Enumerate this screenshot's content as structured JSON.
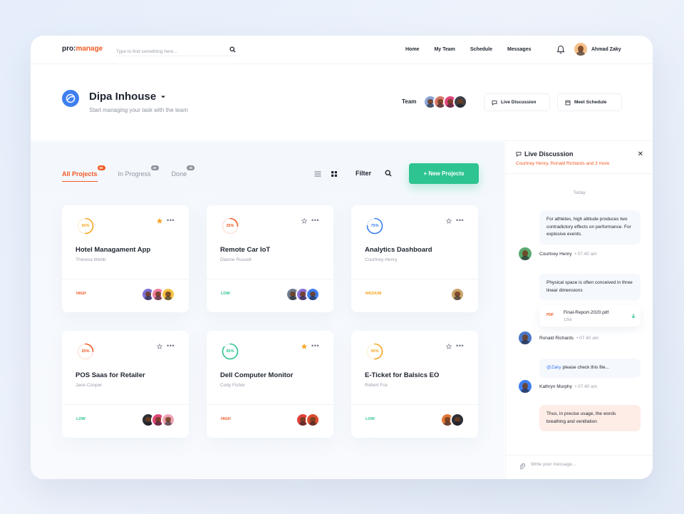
{
  "app": {
    "logo_left": "pro:",
    "logo_right": "manage",
    "search_placeholder": "Type to find something here...",
    "nav": [
      "Home",
      "My Team",
      "Schedule",
      "Messages"
    ],
    "user_name": "Ahmad Zaky"
  },
  "header": {
    "title": "Dipa Inhouse",
    "subtitle": "Start managing your task with the team",
    "team_label": "Team",
    "live_button": "Live Discussion",
    "meet_button": "Meet Schedule",
    "team_avatar_colors": [
      "#8aa4d6",
      "#d9776b",
      "#e0457b",
      "#3b3f47"
    ]
  },
  "toolbar": {
    "tabs": [
      {
        "label": "All Projects",
        "count": "50"
      },
      {
        "label": "In Progress",
        "count": "20"
      },
      {
        "label": "Done",
        "count": "30"
      }
    ],
    "filter_label": "Filter",
    "new_button": "+ New Projects"
  },
  "projects": [
    {
      "title": "Hotel Managament App",
      "owner": "Theresa Webb",
      "progress": "50%",
      "progress_value": 0.5,
      "ring_color": "#f5a623",
      "priority": "HIGH",
      "priority_color": "#f15a24",
      "starred": true,
      "avatars": [
        "#7d6fd6",
        "#f27ea2",
        "#f5c344"
      ]
    },
    {
      "title": "Remote Car IoT",
      "owner": "Dianne Russell",
      "progress": "25%",
      "progress_value": 0.25,
      "ring_color": "#f15a24",
      "priority": "LOW",
      "priority_color": "#2ec491",
      "starred": false,
      "avatars": [
        "#6c7a8c",
        "#8a6fd6",
        "#3f7ff0"
      ]
    },
    {
      "title": "Analytics Dashboard",
      "owner": "Courtney Henry",
      "progress": "75%",
      "progress_value": 0.75,
      "ring_color": "#3f7ff0",
      "priority": "MEDIUM",
      "priority_color": "#f5a623",
      "starred": false,
      "avatars": [
        "#c9a36a"
      ]
    },
    {
      "title": "POS Saas for Retailer",
      "owner": "Jane Cooper",
      "progress": "25%",
      "progress_value": 0.25,
      "ring_color": "#f15a24",
      "priority": "LOW",
      "priority_color": "#2ec491",
      "starred": false,
      "avatars": [
        "#2b2f36",
        "#e0457b",
        "#f0a3b5"
      ]
    },
    {
      "title": "Dell Computer Monitor",
      "owner": "Cody Fisher",
      "progress": "85%",
      "progress_value": 0.85,
      "ring_color": "#2ec491",
      "priority": "HIGH",
      "priority_color": "#f15a24",
      "starred": true,
      "avatars": [
        "#e0413a",
        "#d94c2e"
      ]
    },
    {
      "title": "E-Ticket for Balsics EO",
      "owner": "Robert Fox",
      "progress": "50%",
      "progress_value": 0.5,
      "ring_color": "#f5a623",
      "priority": "LOW",
      "priority_color": "#2ec491",
      "starred": false,
      "avatars": [
        "#e07a3a",
        "#2b2f36"
      ]
    }
  ],
  "chat": {
    "title": "Live Discussion",
    "participants": "Courtney Henry, Ronald Richards and 3 more",
    "day": "Today",
    "messages": [
      {
        "text": "For athletes, high altitude produces two contradictory effects on performance. For explosive events.",
        "author": "Courtney Henry",
        "time": "07.40 am",
        "avatar": "#5aa96e"
      },
      {
        "text": "Physical space is often conceived in three linear dimensions",
        "author": "Ronald Richards",
        "time": "07.40 am",
        "avatar": "#4b78c8"
      },
      {
        "mention": "@Zaky",
        "text": " please check this file...",
        "author": "Kathryn Murphy",
        "time": "07.40 am",
        "avatar": "#3f7ff0"
      },
      {
        "text": "Thus, in precise usage, the words breathing and ventilation"
      }
    ],
    "file": {
      "type": "PDF",
      "name": "Final-Report-2020.pdf",
      "size": "12kb"
    },
    "composer_placeholder": "Write your message..."
  },
  "colors": {
    "accent": "#f15a24",
    "primary": "#3f7ff0",
    "success": "#2ec491",
    "warning": "#f5a623"
  }
}
